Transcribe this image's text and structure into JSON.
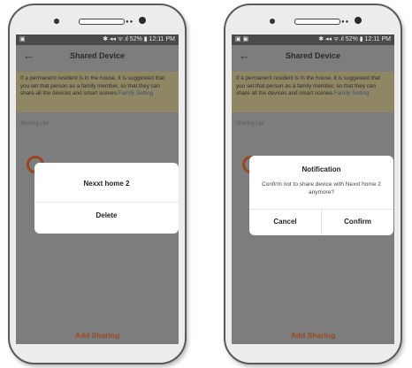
{
  "status_bar": {
    "left_icons": "▣",
    "left_icons_right": "▣ ▣",
    "right_text": "✱ ◂◂ ᯤ.ıl 52% ▮ 12:11 PM"
  },
  "app_bar": {
    "back_icon": "←",
    "title": "Shared Device"
  },
  "notice": {
    "text": "If a permanent resident is in the house, it is suggested that you set that person as a family member, so that they can share all the devices and smart scenes.",
    "link": "Family Setting"
  },
  "sharing_list_label": "Sharing List",
  "add_sharing_label": "Add Sharing",
  "dialog_left": {
    "title": "Nexxt home 2",
    "action": "Delete"
  },
  "dialog_right": {
    "title": "Notification",
    "message": "Confirm not to share device with Nexxt home 2 anymore?",
    "cancel": "Cancel",
    "confirm": "Confirm"
  },
  "colors": {
    "accent": "#9a4a23",
    "link": "#3d4e80",
    "overlay_screen": "#7d7d7d"
  }
}
